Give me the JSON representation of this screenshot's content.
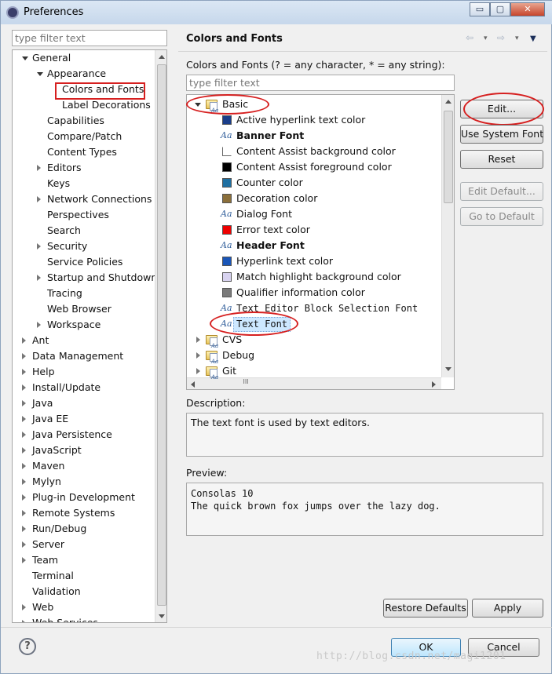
{
  "window": {
    "title": "Preferences",
    "controls": [
      "▭",
      "▢",
      "✕"
    ]
  },
  "filter": {
    "placeholder": "type filter text"
  },
  "nav": {
    "items": [
      {
        "label": "General",
        "level": 0,
        "state": "expanded"
      },
      {
        "label": "Appearance",
        "level": 1,
        "state": "expanded"
      },
      {
        "label": "Colors and Fonts",
        "level": 2,
        "state": "leaf",
        "selected": true
      },
      {
        "label": "Label Decorations",
        "level": 2,
        "state": "leaf"
      },
      {
        "label": "Capabilities",
        "level": 1,
        "state": "leaf"
      },
      {
        "label": "Compare/Patch",
        "level": 1,
        "state": "leaf"
      },
      {
        "label": "Content Types",
        "level": 1,
        "state": "leaf"
      },
      {
        "label": "Editors",
        "level": 1,
        "state": "collapsed"
      },
      {
        "label": "Keys",
        "level": 1,
        "state": "leaf"
      },
      {
        "label": "Network Connections",
        "level": 1,
        "state": "collapsed"
      },
      {
        "label": "Perspectives",
        "level": 1,
        "state": "leaf"
      },
      {
        "label": "Search",
        "level": 1,
        "state": "leaf"
      },
      {
        "label": "Security",
        "level": 1,
        "state": "collapsed"
      },
      {
        "label": "Service Policies",
        "level": 1,
        "state": "leaf"
      },
      {
        "label": "Startup and Shutdown",
        "level": 1,
        "state": "collapsed"
      },
      {
        "label": "Tracing",
        "level": 1,
        "state": "leaf"
      },
      {
        "label": "Web Browser",
        "level": 1,
        "state": "leaf"
      },
      {
        "label": "Workspace",
        "level": 1,
        "state": "collapsed"
      },
      {
        "label": "Ant",
        "level": 0,
        "state": "collapsed"
      },
      {
        "label": "Data Management",
        "level": 0,
        "state": "collapsed"
      },
      {
        "label": "Help",
        "level": 0,
        "state": "collapsed"
      },
      {
        "label": "Install/Update",
        "level": 0,
        "state": "collapsed"
      },
      {
        "label": "Java",
        "level": 0,
        "state": "collapsed"
      },
      {
        "label": "Java EE",
        "level": 0,
        "state": "collapsed"
      },
      {
        "label": "Java Persistence",
        "level": 0,
        "state": "collapsed"
      },
      {
        "label": "JavaScript",
        "level": 0,
        "state": "collapsed"
      },
      {
        "label": "Maven",
        "level": 0,
        "state": "collapsed"
      },
      {
        "label": "Mylyn",
        "level": 0,
        "state": "collapsed"
      },
      {
        "label": "Plug-in Development",
        "level": 0,
        "state": "collapsed"
      },
      {
        "label": "Remote Systems",
        "level": 0,
        "state": "collapsed"
      },
      {
        "label": "Run/Debug",
        "level": 0,
        "state": "collapsed"
      },
      {
        "label": "Server",
        "level": 0,
        "state": "collapsed"
      },
      {
        "label": "Team",
        "level": 0,
        "state": "collapsed"
      },
      {
        "label": "Terminal",
        "level": 0,
        "state": "leaf"
      },
      {
        "label": "Validation",
        "level": 0,
        "state": "leaf"
      },
      {
        "label": "Web",
        "level": 0,
        "state": "collapsed"
      },
      {
        "label": "Web Services",
        "level": 0,
        "state": "collapsed"
      }
    ]
  },
  "page": {
    "title": "Colors and Fonts",
    "nav_arrows": [
      "⇦",
      "▾",
      "⇨",
      "▾",
      "▼"
    ],
    "instruction": "Colors and Fonts (? = any character, * = any string):",
    "filter_placeholder": "type filter text"
  },
  "tree": {
    "rows": [
      {
        "label": "Basic",
        "type": "category",
        "state": "expanded"
      },
      {
        "label": "Active hyperlink text color",
        "type": "color",
        "color": "#1a3e8a"
      },
      {
        "label": "Banner Font",
        "type": "font",
        "bold": true
      },
      {
        "label": "Content Assist background color",
        "type": "color",
        "color": "#ffffff"
      },
      {
        "label": "Content Assist foreground color",
        "type": "color",
        "color": "#000000"
      },
      {
        "label": "Counter color",
        "type": "color",
        "color": "#1f6fa1"
      },
      {
        "label": "Decoration color",
        "type": "color",
        "color": "#8b6f3a"
      },
      {
        "label": "Dialog Font",
        "type": "font"
      },
      {
        "label": "Error text color",
        "type": "color",
        "color": "#ee0000"
      },
      {
        "label": "Header Font",
        "type": "font",
        "bold": true
      },
      {
        "label": "Hyperlink text color",
        "type": "color",
        "color": "#1a56b8"
      },
      {
        "label": "Match highlight background color",
        "type": "color",
        "color": "#d8d3f0"
      },
      {
        "label": "Qualifier information color",
        "type": "color",
        "color": "#7a7a7a"
      },
      {
        "label": "Text Editor Block Selection Font",
        "type": "font",
        "mono": true
      },
      {
        "label": "Text Font",
        "type": "font",
        "mono": true,
        "selected": true
      },
      {
        "label": "CVS",
        "type": "category",
        "state": "collapsed"
      },
      {
        "label": "Debug",
        "type": "category",
        "state": "collapsed"
      },
      {
        "label": "Git",
        "type": "category",
        "state": "collapsed"
      }
    ],
    "hscroll_grip": "III"
  },
  "buttons": {
    "edit": "Edit...",
    "use_system_font": "Use System Font",
    "reset": "Reset",
    "edit_default": "Edit Default...",
    "go_to_default": "Go to Default",
    "restore_defaults": "Restore Defaults",
    "apply": "Apply",
    "ok": "OK",
    "cancel": "Cancel"
  },
  "description": {
    "label": "Description:",
    "text": "The text font is used by text editors."
  },
  "preview": {
    "label": "Preview:",
    "line1": "Consolas 10",
    "line2": "The quick brown fox jumps over the lazy dog."
  },
  "help_glyph": "?",
  "watermark": "http://blog.csdn.net/magi1201",
  "colors": {
    "annotation": "#d62020",
    "selection": "#cde8ff"
  }
}
